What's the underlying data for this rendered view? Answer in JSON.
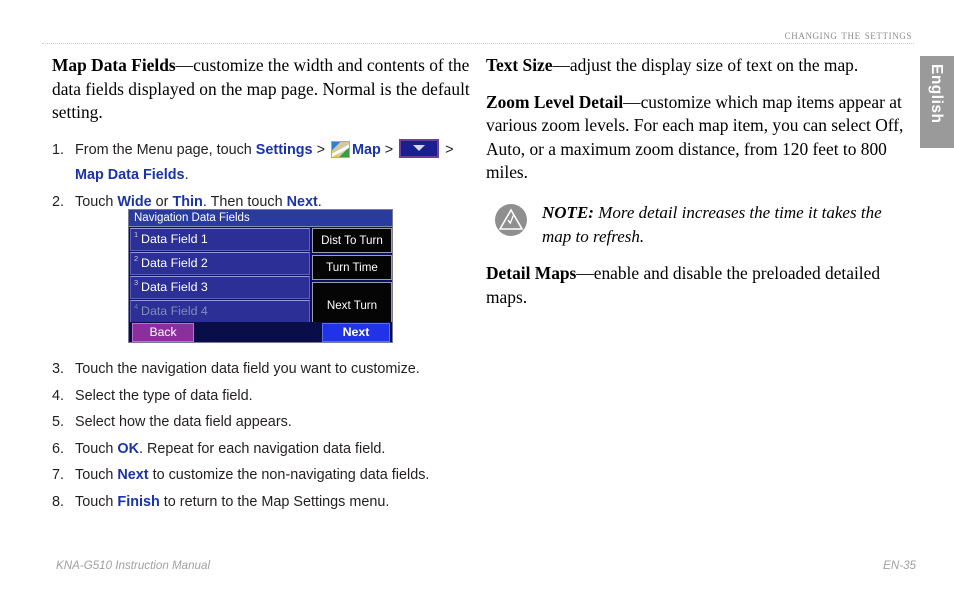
{
  "header": {
    "title": "Changing the Settings"
  },
  "language_tab": {
    "label": "English"
  },
  "left_column": {
    "intro": {
      "term": "Map Data Fields",
      "dash": "—",
      "body": "customize the width and contents of the data fields displayed on the map page. Normal is the default setting."
    },
    "steps_before": [
      {
        "num": "1.",
        "parts": [
          {
            "type": "text",
            "value": "From the Menu page, touch "
          },
          {
            "type": "kw",
            "value": "Settings"
          },
          {
            "type": "text",
            "value": " > "
          },
          {
            "type": "icon",
            "value": "map-icon"
          },
          {
            "type": "kw",
            "value": "Map"
          },
          {
            "type": "text",
            "value": " > "
          },
          {
            "type": "icon",
            "value": "dropdown-icon"
          },
          {
            "type": "text",
            "value": " > "
          },
          {
            "type": "kw",
            "value": "Map Data Fields"
          },
          {
            "type": "text",
            "value": "."
          }
        ]
      },
      {
        "num": "2.",
        "parts": [
          {
            "type": "text",
            "value": "Touch "
          },
          {
            "type": "kw",
            "value": "Wide"
          },
          {
            "type": "text",
            "value": " or "
          },
          {
            "type": "kw",
            "value": "Thin"
          },
          {
            "type": "text",
            "value": ". Then touch "
          },
          {
            "type": "kw",
            "value": "Next"
          },
          {
            "type": "text",
            "value": "."
          }
        ]
      }
    ],
    "steps_after": [
      {
        "num": "3.",
        "parts": [
          {
            "type": "text",
            "value": "Touch the navigation data field you want to customize."
          }
        ]
      },
      {
        "num": "4.",
        "parts": [
          {
            "type": "text",
            "value": "Select the type of data field."
          }
        ]
      },
      {
        "num": "5.",
        "parts": [
          {
            "type": "text",
            "value": "Select how the data field appears."
          }
        ]
      },
      {
        "num": "6.",
        "parts": [
          {
            "type": "text",
            "value": "Touch "
          },
          {
            "type": "kw",
            "value": "OK"
          },
          {
            "type": "text",
            "value": ". Repeat for each navigation data field."
          }
        ]
      },
      {
        "num": "7.",
        "parts": [
          {
            "type": "text",
            "value": "Touch "
          },
          {
            "type": "kw",
            "value": "Next"
          },
          {
            "type": "text",
            "value": " to customize the non-navigating data fields."
          }
        ]
      },
      {
        "num": "8.",
        "parts": [
          {
            "type": "text",
            "value": "Touch "
          },
          {
            "type": "kw",
            "value": "Finish"
          },
          {
            "type": "text",
            "value": " to return to the Map Settings menu."
          }
        ]
      }
    ]
  },
  "gps_screen": {
    "title": "Navigation Data Fields",
    "rows": [
      {
        "num": "1",
        "label": "Data Field 1",
        "dim": false
      },
      {
        "num": "2",
        "label": "Data Field 2",
        "dim": false
      },
      {
        "num": "3",
        "label": "Data Field 3",
        "dim": false
      },
      {
        "num": "4",
        "label": "Data Field 4",
        "dim": true
      }
    ],
    "buttons": [
      {
        "label": "Dist To Turn"
      },
      {
        "label": "Turn Time"
      },
      {
        "label": "Next Turn"
      }
    ],
    "back_label": "Back",
    "next_label": "Next"
  },
  "right_column": {
    "text_size": {
      "term": "Text Size",
      "dash": "—",
      "body": "adjust the display size of text on the map."
    },
    "zoom_level_detail": {
      "term": "Zoom Level Detail",
      "dash": "—",
      "body": "customize which map items appear at various zoom levels. For each map item, you can select Off, Auto, or a maximum zoom distance, from 120 feet to 800 miles."
    },
    "note": {
      "label": "NOTE:",
      "body": "More detail increases the time it takes the map to refresh."
    },
    "detail_maps": {
      "term": "Detail Maps",
      "dash": "—",
      "body": "enable and disable the preloaded detailed maps."
    }
  },
  "footer": {
    "left": "KNA-G510 Instruction Manual",
    "right": "EN-35"
  },
  "colors": {
    "keyword_blue": "#1a33a6",
    "header_gray": "#8c8c8c",
    "footer_gray": "#a0a0a0",
    "tab_gray": "#9a9a9a",
    "gps_titlebar": "#2a3ba0",
    "gps_row": "#2b2f96",
    "gps_back": "#8c2f9e",
    "gps_next": "#2033e8"
  }
}
